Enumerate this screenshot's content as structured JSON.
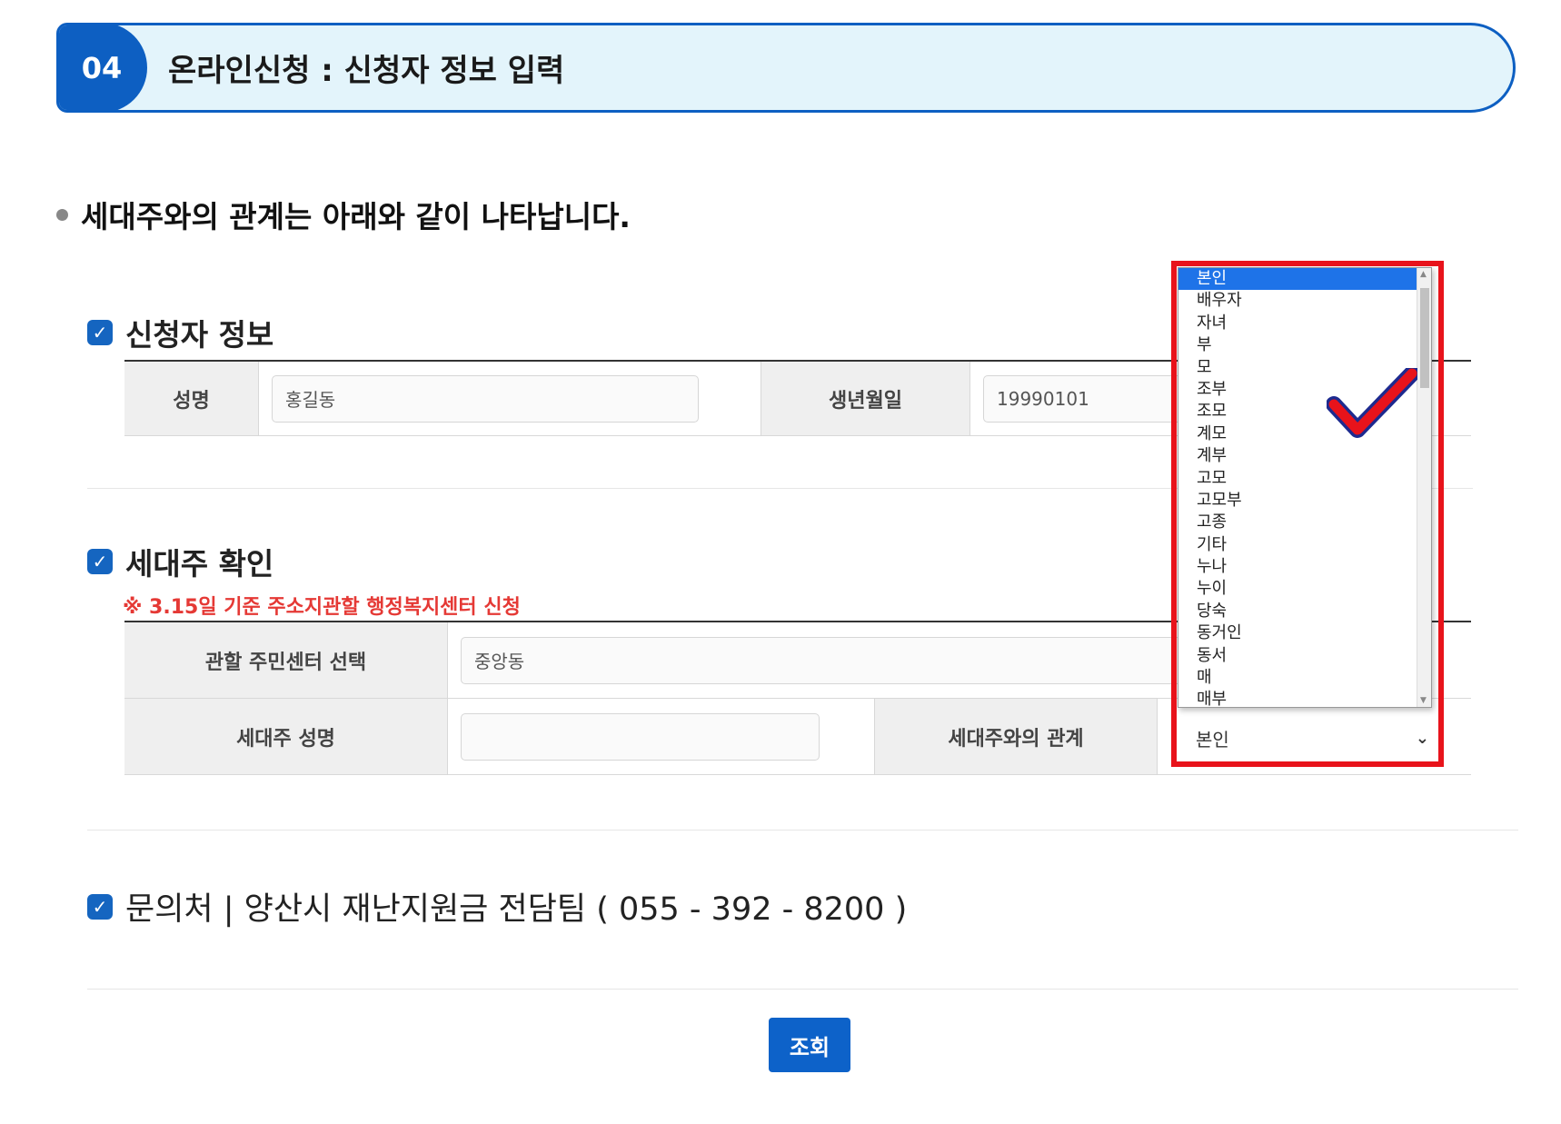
{
  "banner": {
    "number": "04",
    "title": "온라인신청 : 신청자 정보 입력"
  },
  "intro": "세대주와의 관계는 아래와 같이 나타납니다.",
  "applicant": {
    "heading": "신청자 정보",
    "name_label": "성명",
    "name_value": "홍길동",
    "birth_label": "생년월일",
    "birth_value": "19990101"
  },
  "householder": {
    "heading": "세대주 확인",
    "note": "※ 3.15일 기준 주소지관할 행정복지센터 신청",
    "center_label": "관할 주민센터 선택",
    "center_value": "중앙동",
    "name_label": "세대주 성명",
    "name_value": "",
    "relation_label": "세대주와의 관계",
    "relation_value": "본인",
    "relation_options": [
      "본인",
      "배우자",
      "자녀",
      "부",
      "모",
      "조부",
      "조모",
      "계모",
      "계부",
      "고모",
      "고모부",
      "고종",
      "기타",
      "누나",
      "누이",
      "당숙",
      "동거인",
      "동서",
      "매",
      "매부"
    ]
  },
  "contact": {
    "heading": "문의처 | 양산시 재난지원금 전담팀 ( 055 - 392 - 8200 )"
  },
  "submit_label": "조회",
  "colors": {
    "primary": "#0d5fc2",
    "highlight": "#e8131b",
    "note": "#e53935"
  }
}
